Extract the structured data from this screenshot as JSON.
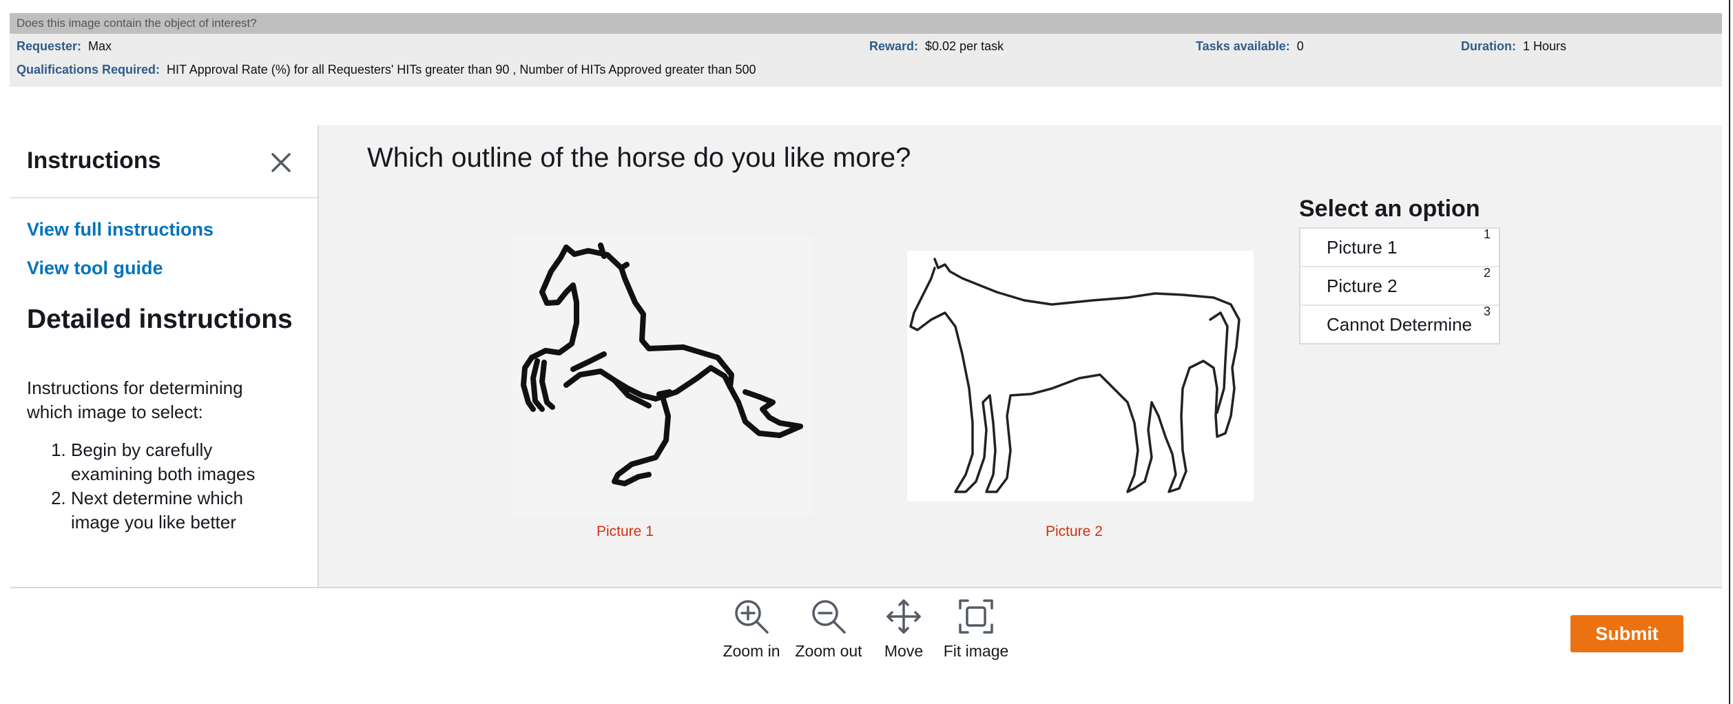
{
  "hit": {
    "title": "Does this image contain the object of interest?",
    "requester_label": "Requester:",
    "requester_value": "Max",
    "reward_label": "Reward:",
    "reward_value": "$0.02 per task",
    "tasks_label": "Tasks available:",
    "tasks_value": "0",
    "duration_label": "Duration:",
    "duration_value": "1 Hours",
    "qual_label": "Qualifications Required:",
    "qual_value": "HIT Approval Rate (%) for all Requesters' HITs greater than 90 , Number of HITs Approved greater than 500"
  },
  "instructions": {
    "title": "Instructions",
    "view_full": "View full instructions",
    "view_tool": "View tool guide",
    "detail_title": "Detailed instructions",
    "intro": "Instructions for determining which image to select:",
    "steps": [
      "Begin by carefully examining both images",
      "Next determine which image you like better"
    ]
  },
  "main": {
    "question": "Which outline of the horse do you like more?",
    "picture1_label": "Picture 1",
    "picture2_label": "Picture 2"
  },
  "options": {
    "title": "Select an option",
    "items": [
      {
        "label": "Picture 1",
        "key": "1"
      },
      {
        "label": "Picture 2",
        "key": "2"
      },
      {
        "label": "Cannot Determine",
        "key": "3"
      }
    ]
  },
  "toolbar": {
    "zoom_in": "Zoom in",
    "zoom_out": "Zoom out",
    "move": "Move",
    "fit": "Fit image",
    "submit": "Submit"
  },
  "colors": {
    "link": "#0073bb",
    "picture_label": "#d13212",
    "submit": "#ec7211",
    "requester_label": "#2f5c8a"
  }
}
